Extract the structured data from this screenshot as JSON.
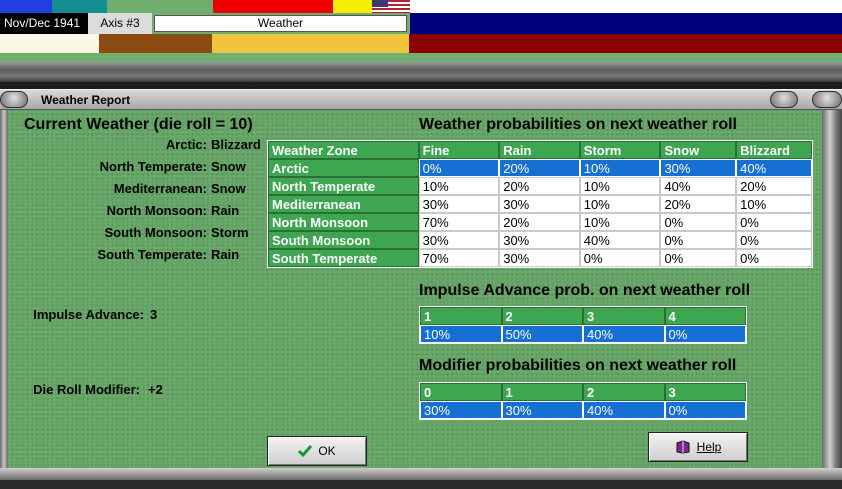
{
  "top": {
    "date": "Nov/Dec 1941",
    "axis": "Axis #3",
    "tab": "Weather"
  },
  "window": {
    "title": "Weather Report"
  },
  "current": {
    "heading": "Current Weather (die roll = 10)",
    "zones": [
      {
        "label": "Arctic:",
        "value": "Blizzard"
      },
      {
        "label": "North Temperate:",
        "value": "Snow"
      },
      {
        "label": "Mediterranean:",
        "value": "Snow"
      },
      {
        "label": "North Monsoon:",
        "value": "Rain"
      },
      {
        "label": "South Monsoon:",
        "value": "Storm"
      },
      {
        "label": "South Temperate:",
        "value": "Rain"
      }
    ],
    "impulse_label": "Impulse Advance:",
    "impulse_value": "3",
    "modifier_label": "Die Roll Modifier:",
    "modifier_value": "+2"
  },
  "weather_table": {
    "heading": "Weather probabilities on next weather roll",
    "columns": [
      "Weather Zone",
      "Fine",
      "Rain",
      "Storm",
      "Snow",
      "Blizzard"
    ],
    "rows": [
      [
        "Arctic",
        "0%",
        "20%",
        "10%",
        "30%",
        "40%"
      ],
      [
        "North Temperate",
        "10%",
        "20%",
        "10%",
        "40%",
        "20%"
      ],
      [
        "Mediterranean",
        "30%",
        "30%",
        "10%",
        "20%",
        "10%"
      ],
      [
        "North Monsoon",
        "70%",
        "20%",
        "10%",
        "0%",
        "0%"
      ],
      [
        "South Monsoon",
        "30%",
        "30%",
        "40%",
        "0%",
        "0%"
      ],
      [
        "South Temperate",
        "70%",
        "30%",
        "0%",
        "0%",
        "0%"
      ]
    ],
    "selected_row": 0
  },
  "impulse_table": {
    "heading": "Impulse Advance prob. on next weather roll",
    "columns": [
      "1",
      "2",
      "3",
      "4"
    ],
    "row": [
      "10%",
      "50%",
      "40%",
      "0%"
    ]
  },
  "modifier_table": {
    "heading": "Modifier probabilities on next weather roll",
    "columns": [
      "0",
      "1",
      "2",
      "3"
    ],
    "row": [
      "30%",
      "30%",
      "40%",
      "0%"
    ]
  },
  "buttons": {
    "ok": "OK",
    "help": "Help"
  },
  "colors": {
    "panel_green": "#64a464",
    "header_green": "#3ea550",
    "selected_blue": "#1670d4",
    "strip_blue": "#00007f",
    "strip_red": "#8b0000",
    "strip_gold": "#f0c43c",
    "strip_brown": "#8b4a10"
  }
}
